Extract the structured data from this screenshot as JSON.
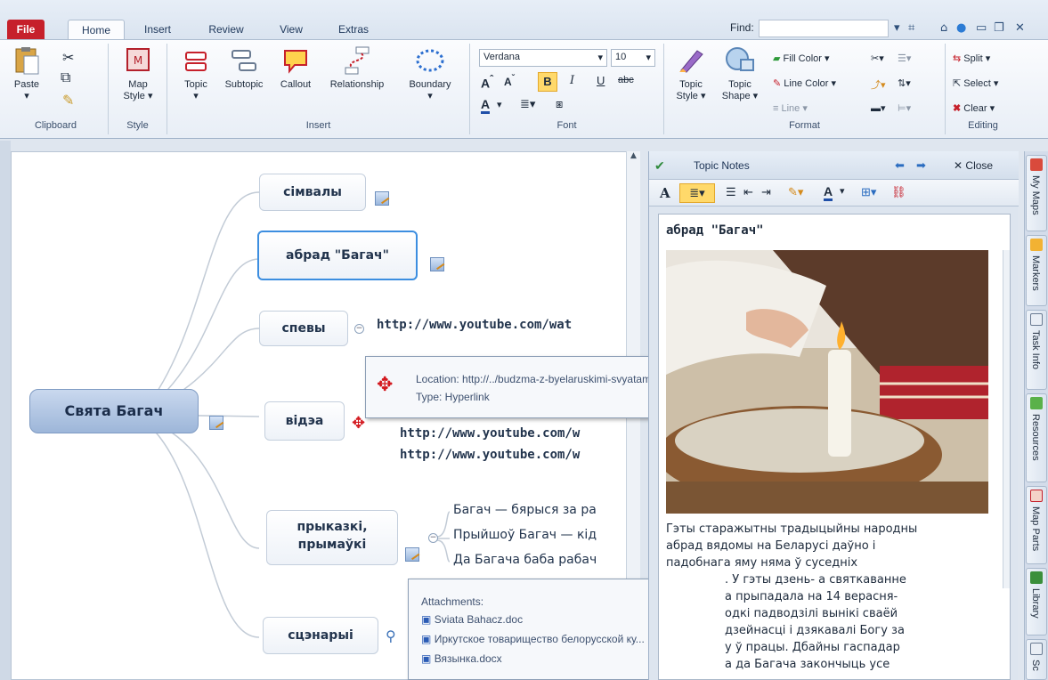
{
  "tabs": {
    "file": "File",
    "home": "Home",
    "insert": "Insert",
    "review": "Review",
    "view": "View",
    "extras": "Extras",
    "find_label": "Find:"
  },
  "ribbon": {
    "clipboard": {
      "paste": "Paste",
      "label": "Clipboard"
    },
    "style": {
      "map_style": "Map",
      "map_style2": "Style ▾",
      "label": "Style"
    },
    "insert": {
      "topic": "Topic",
      "subtopic": "Subtopic",
      "callout": "Callout",
      "relationship": "Relationship",
      "boundary": "Boundary",
      "label": "Insert"
    },
    "font": {
      "family": "Verdana",
      "size": "10",
      "label": "Font"
    },
    "format": {
      "topic_style1": "Topic",
      "topic_style2": "Style ▾",
      "topic_shape1": "Topic",
      "topic_shape2": "Shape ▾",
      "fill_color": "Fill Color ▾",
      "line_color": "Line Color ▾",
      "line": "Line ▾",
      "label": "Format"
    },
    "editing": {
      "split": "Split ▾",
      "select": "Select ▾",
      "clear": "Clear ▾",
      "label": "Editing"
    }
  },
  "map": {
    "central": "Свята Багач",
    "topics": [
      "сімвалы",
      "абрад \"Багач\"",
      "спевы",
      "відэа",
      "прыказкі,\nпрымаўкі",
      "сцэнарыі"
    ],
    "spevy_link": "http://www.youtube.com/wat",
    "video_links": [
      "http://www.youtube.com/w",
      "http://www.youtube.com/w"
    ],
    "sayings": [
      "Багач — бярыся за ра",
      "Прыйшоў Багач — кід",
      "Да Багача баба рабач"
    ]
  },
  "hyperlink_tip": {
    "location": "Location: http://../budzma-z-byelaruskimi-svyatami-bahach.html",
    "type": "Type: Hyperlink"
  },
  "attachments": {
    "title": "Attachments:",
    "files": [
      "Sviata Bahacz.doc",
      "Иркутское товарищество белорусской ку...",
      "Вязынка.docx"
    ]
  },
  "notes": {
    "title": "Topic Notes",
    "close": "Close",
    "heading": "абрад \"Багач\"",
    "body": [
      "Гэты старажытны традыцыйны народны",
      "абрад вядомы на Беларусі даўно і",
      "падобнага яму няма ў суседніх",
      ". У гэты дзень- а святкаванне",
      "а прыпадала на 14 верасня-",
      "одкі падводзілі вынікі сваёй",
      "дзейнасці і дзякавалі Богу за",
      "у ў працы. Дбайны гаспадар",
      "а да Багача закончыць усе"
    ]
  },
  "rail": [
    "My Maps",
    "Markers",
    "Task Info",
    "Resources",
    "Map Parts",
    "Library",
    "Sc"
  ],
  "colors": {
    "accent": "#c6202b",
    "central_fill": "#9db6d9",
    "topic_border": "#c4cfdd"
  }
}
